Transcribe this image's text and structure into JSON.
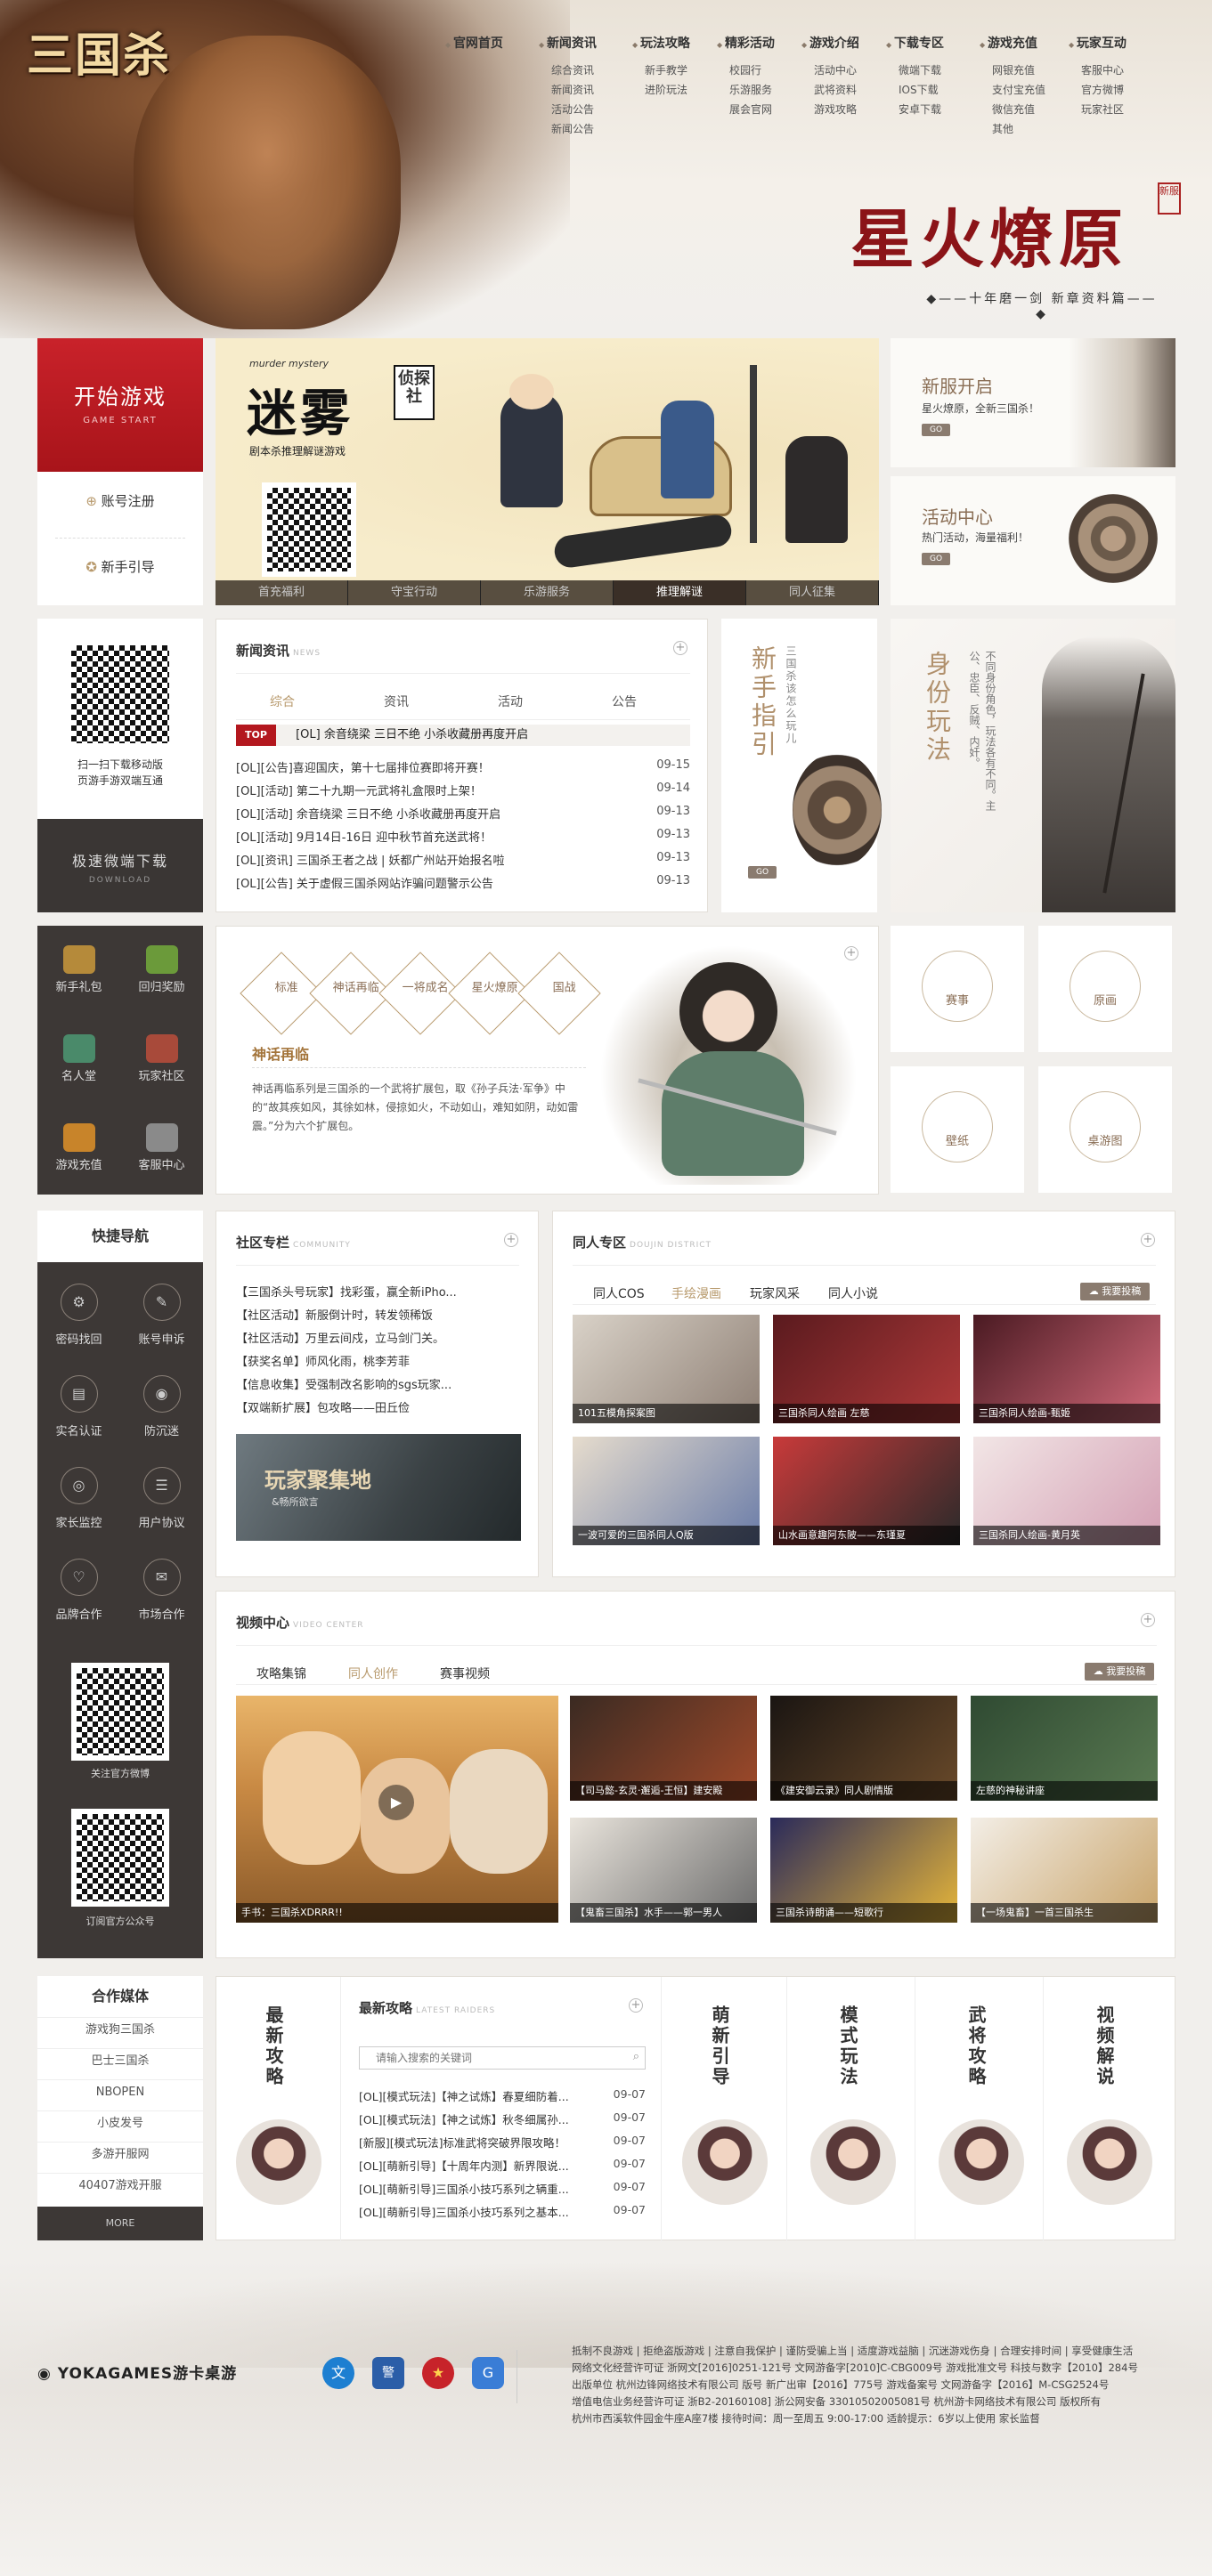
{
  "logo": {
    "text": "三国杀"
  },
  "nav": [
    {
      "title": "官网首页",
      "items": []
    },
    {
      "title": "新闻资讯",
      "items": [
        "综合资讯",
        "新闻资讯",
        "活动公告",
        "新闻公告"
      ]
    },
    {
      "title": "玩法攻略",
      "items": [
        "新手教学",
        "进阶玩法"
      ]
    },
    {
      "title": "精彩活动",
      "items": [
        "校园行",
        "乐游服务",
        "展会官网"
      ]
    },
    {
      "title": "游戏介绍",
      "items": [
        "活动中心",
        "武将资料",
        "游戏攻略"
      ]
    },
    {
      "title": "下载专区",
      "items": [
        "微端下载",
        "IOS下载",
        "安卓下载"
      ]
    },
    {
      "title": "游戏充值",
      "items": [
        "网银充值",
        "支付宝充值",
        "微信充值",
        "其他"
      ]
    },
    {
      "title": "玩家互动",
      "items": [
        "客服中心",
        "官方微博",
        "玩家社区"
      ]
    }
  ],
  "slogan": {
    "main": "星火燎原",
    "seal": "新服",
    "sub": "十年磨一剑 新章资料篇"
  },
  "start": {
    "title": "开始游戏",
    "en": "GAME START",
    "register": "账号注册",
    "guide": "新手引导"
  },
  "banner": {
    "title": "迷雾",
    "badge": "侦探社",
    "en": "murder mystery",
    "sub": "剧本杀推理解谜游戏",
    "tabs": [
      "首充福利",
      "守宝行动",
      "乐游服务",
      "推理解谜",
      "同人征集"
    ],
    "active_tab": 3
  },
  "promos": [
    {
      "title": "新服开启",
      "desc": "星火燎原，全新三国杀！",
      "go": "GO"
    },
    {
      "title": "活动中心",
      "desc": "热门活动，海量福利！",
      "go": "GO"
    }
  ],
  "download": {
    "qr_text": "扫一扫下载移动版\n页游手游双端互通",
    "btn": "极速微端下载",
    "btn_en": "DOWNLOAD"
  },
  "news": {
    "title": "新闻资讯",
    "title_en": "NEWS",
    "tabs": [
      "综合",
      "资讯",
      "活动",
      "公告"
    ],
    "top_label": "TOP",
    "top_text": "[OL] 余音绕梁 三日不绝 小杀收藏册再度开启",
    "rows": [
      {
        "t": "[OL][公告]喜迎国庆，第十七届排位赛即将开赛！",
        "d": "09-15"
      },
      {
        "t": "[OL][活动] 第二十九期一元武将礼盒限时上架！",
        "d": "09-14"
      },
      {
        "t": "[OL][活动] 余音绕梁 三日不绝 小杀收藏册再度开启",
        "d": "09-13"
      },
      {
        "t": "[OL][活动] 9月14日-16日 迎中秋节首充送武将！",
        "d": "09-13"
      },
      {
        "t": "[OL][资讯] 三国杀王者之战 | 妖都广州站开始报名啦",
        "d": "09-13"
      },
      {
        "t": "[OL][公告] 关于虚假三国杀网站诈骗问题警示公告",
        "d": "09-13"
      }
    ]
  },
  "guide": {
    "title": "新手指引",
    "sub": "三国杀该怎么玩儿",
    "go": "GO"
  },
  "identity": {
    "title": "身份玩法",
    "text": "不同身份角色，玩法各有不同。主公、忠臣、反贼、内奸。"
  },
  "icon_grid": [
    "新手礼包",
    "回归奖励",
    "名人堂",
    "玩家社区",
    "游戏充值",
    "客服中心"
  ],
  "hero2": {
    "tags": [
      "标准",
      "神话再临",
      "一将成名",
      "星火燎原",
      "国战"
    ],
    "name": "神话再临",
    "desc": "神话再临系列是三国杀的一个武将扩展包，取《孙子兵法·军争》中的“故其疾如风，其徐如林，侵掠如火，不动如山，难知如阴，动如雷震。”分为六个扩展包。"
  },
  "cats": [
    "赛事",
    "原画",
    "壁纸",
    "桌游图"
  ],
  "quicknav": {
    "title": "快捷导航",
    "items": [
      "密码找回",
      "账号申诉",
      "实名认证",
      "防沉迷",
      "家长监控",
      "用户协议",
      "品牌合作",
      "市场合作"
    ],
    "weibo": "关注官方微博",
    "wechat": "订阅官方公众号"
  },
  "community": {
    "title": "社区专栏",
    "title_en": "COMMUNITY",
    "rows": [
      "【三国杀头号玩家】找彩蛋，赢全新iPho...",
      "【社区活动】新服倒计时，转发领稀饭",
      "【社区活动】万里云间戍，立马剑门关。",
      "【获奖名单】师风化雨，桃李芳菲",
      "【信息收集】受强制改名影响的sgs玩家...",
      "【双端新扩展】包攻略——田丘俭"
    ],
    "banner": "玩家聚集地",
    "banner_sub": "&畅所欲言"
  },
  "doujin": {
    "title": "同人专区",
    "title_en": "DOUJIN DISTRICT",
    "tabs": [
      "同人COS",
      "手绘漫画",
      "玩家风采",
      "同人小说"
    ],
    "active": 1,
    "upload": "我要投稿",
    "items": [
      "101五模角探案图",
      "三国杀同人绘画 左慈",
      "三国杀同人绘画-甄姬",
      "一波可爱的三国杀同人Q版",
      "山水画意趣阿东陂——东瑾夏",
      "三国杀同人绘画-黄月英"
    ]
  },
  "video": {
    "title": "视频中心",
    "title_en": "VIDEO CENTER",
    "tabs": [
      "攻略集锦",
      "同人创作",
      "赛事视频"
    ],
    "active": 1,
    "upload": "我要投稿",
    "main": "手书：三国杀XDRRR!!",
    "items": [
      "【司马懿-玄灵·邂逅-王恒】建安殿",
      "《建安御云录》同人剧情版",
      "左慈的神秘讲座",
      "【鬼畜三国杀】水手——郭一男人",
      "三国杀诗朗诵——短歌行",
      "【一场鬼畜】一首三国杀生"
    ]
  },
  "partner": {
    "title": "合作媒体",
    "items": [
      "游戏狗三国杀",
      "巴士三国杀",
      "NBOPEN",
      "小皮发号",
      "多游开服网",
      "40407游戏开服"
    ],
    "more": "MORE"
  },
  "strategy": {
    "cols": [
      "最新攻略",
      "萌新引导",
      "模式玩法",
      "武将攻略",
      "视频解说"
    ],
    "title": "最新攻略",
    "title_en": "LATEST RAIDERS",
    "search_placeholder": "请输入搜索的关键词",
    "rows": [
      {
        "t": "[OL][模式玩法]【神之试炼】春夏细防着...",
        "d": "09-07"
      },
      {
        "t": "[OL][模式玩法]【神之试炼】秋冬细属孙...",
        "d": "09-07"
      },
      {
        "t": "[新服][模式玩法]标准武将突破界限攻略！",
        "d": "09-07"
      },
      {
        "t": "[OL][萌新引导]【十周年内测】新界限说...",
        "d": "09-07"
      },
      {
        "t": "[OL][萌新引导]三国杀小技巧系列之辆重...",
        "d": "09-07"
      },
      {
        "t": "[OL][萌新引导]三国杀小技巧系列之基本...",
        "d": "09-07"
      }
    ]
  },
  "footer": {
    "brand": "YOKAGAMES游卡桌游",
    "lines": [
      "抵制不良游戏 | 拒绝盗版游戏 | 注意自我保护 | 谨防受骗上当 | 适度游戏益脑 | 沉迷游戏伤身 | 合理安排时间 | 享受健康生活",
      "网络文化经营许可证 浙网文[2016]0251-121号 文网游备字[2010]C-CBG009号 游戏批准文号 科技与数字【2010】284号",
      "出版单位 杭州边锋网络技术有限公司 版号 新广出审【2016】775号 游戏备案号 文网游备字【2016】M-CSG2524号",
      "增值电信业务经营许可证 浙B2-20160108] 浙公网安备 33010502005081号 杭州游卡网络技术有限公司 版权所有",
      "杭州市西溪软件园金牛座A座7楼 接待时间：周一至周五 9:00-17:00 适龄提示：6岁以上使用 家长监督"
    ]
  },
  "colors": {
    "accent": "#b89a6d",
    "red": "#b3171e",
    "dark": "#3d3836"
  }
}
